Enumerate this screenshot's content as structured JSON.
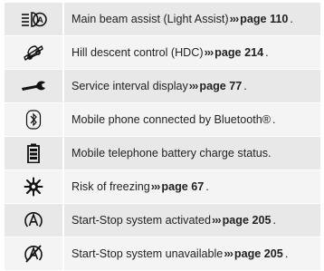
{
  "rows": [
    {
      "icon": "main-beam-assist-icon",
      "text": "Main beam assist (Light Assist)",
      "arrows": "›››",
      "page": "page 110",
      "end": "."
    },
    {
      "icon": "hill-descent-icon",
      "text": "Hill descent control (HDC)",
      "arrows": "›››",
      "page": "page 214",
      "end": "."
    },
    {
      "icon": "wrench-icon",
      "text": "Service interval display",
      "arrows": "›››",
      "page": "page 77",
      "end": "."
    },
    {
      "icon": "bluetooth-icon",
      "text": "Mobile phone connected by Bluetooth®",
      "arrows": "",
      "page": "",
      "end": "."
    },
    {
      "icon": "phone-battery-icon",
      "text": "Mobile telephone battery charge status.",
      "arrows": "",
      "page": "",
      "end": ""
    },
    {
      "icon": "snowflake-icon",
      "text": "Risk of freezing",
      "arrows": "›››",
      "page": "page 67",
      "end": "."
    },
    {
      "icon": "start-stop-active-icon",
      "text": "Start-Stop system activated",
      "arrows": "›››",
      "page": "page 205",
      "end": "."
    },
    {
      "icon": "start-stop-unavailable-icon",
      "text": "Start-Stop system unavailable",
      "arrows": "›››",
      "page": "page 205",
      "end": "."
    }
  ]
}
